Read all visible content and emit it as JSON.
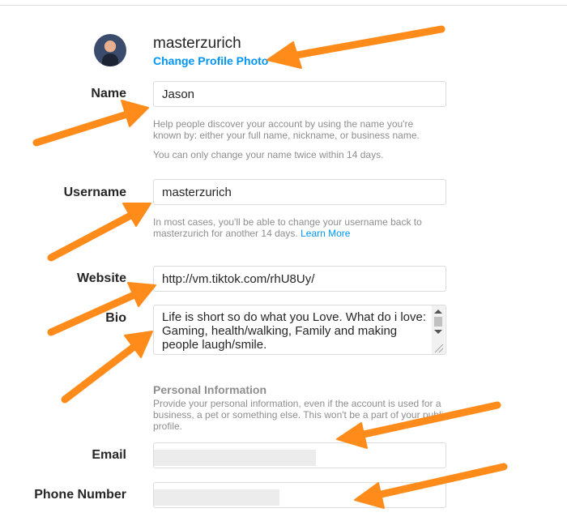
{
  "profile": {
    "username": "masterzurich",
    "change_photo_label": "Change Profile Photo"
  },
  "fields": {
    "name": {
      "label": "Name",
      "value": "Jason"
    },
    "name_help_1": "Help people discover your account by using the name you're known by: either your full name, nickname, or business name.",
    "name_help_2": "You can only change your name twice within 14 days.",
    "username": {
      "label": "Username",
      "value": "masterzurich"
    },
    "username_help": "In most cases, you'll be able to change your username back to masterzurich for another 14 days.",
    "username_help_link": "Learn More",
    "website": {
      "label": "Website",
      "value": "http://vm.tiktok.com/rhU8Uy/"
    },
    "bio": {
      "label": "Bio",
      "value": "Life is short so do what you Love. What do i love: Gaming, health/walking, Family and making people laugh/smile."
    }
  },
  "personal_info": {
    "title": "Personal Information",
    "description": "Provide your personal information, even if the account is used for a business, a pet or something else. This won't be a part of your public profile.",
    "email_label": "Email",
    "phone_label": "Phone Number"
  },
  "colors": {
    "accent": "#0095f6",
    "arrow": "#ff8c1a"
  }
}
